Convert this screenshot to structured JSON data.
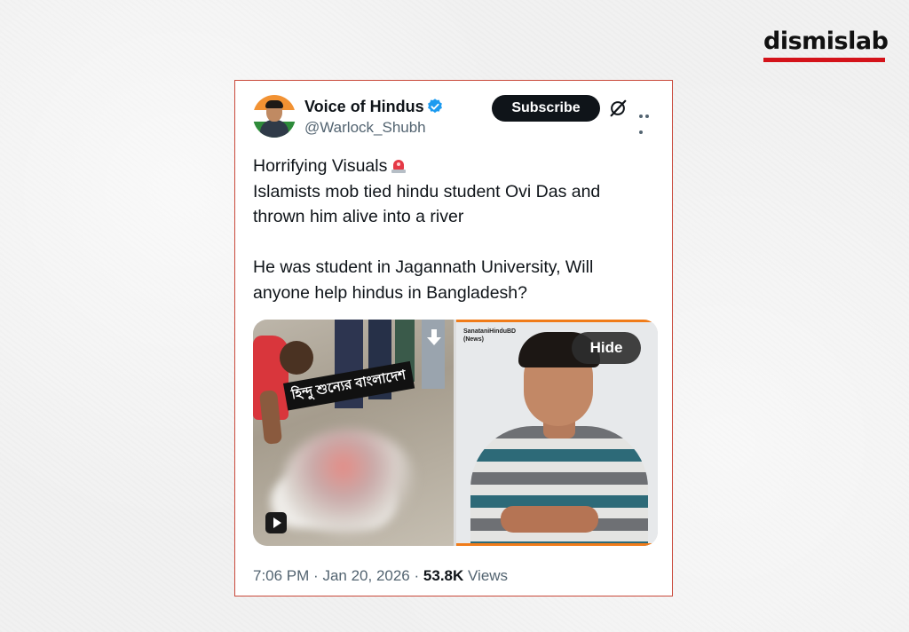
{
  "brand": {
    "name": "dismislab",
    "accent_color": "#d4131a"
  },
  "tweet": {
    "display_name": "Voice of Hindus",
    "handle": "@Warlock_Shubh",
    "verified": true,
    "subscribe_label": "Subscribe",
    "text_lines_1": [
      "Horrifying Visuals",
      "Islamists mob tied hindu student Ovi Das and",
      "thrown him alive into a river"
    ],
    "text_lines_2": [
      "He was student in Jagannath University, Will",
      "anyone help hindus in Bangladesh?"
    ],
    "emoji": "siren-icon",
    "media": {
      "left_overlay_text": "হিন্দু শুন্যের বাংলাদেশ",
      "right_source_label_1": "SanataniHinduBD",
      "right_source_label_2": "(News)",
      "hide_label": "Hide"
    },
    "time": "7:06 PM",
    "separator": "·",
    "date": "Jan 20, 2026",
    "views_count": "53.8K",
    "views_label": "Views"
  },
  "colors": {
    "card_border": "#c9483a",
    "verified_blue": "#1d9bf0",
    "text": "#0f1419",
    "muted": "#536471"
  }
}
